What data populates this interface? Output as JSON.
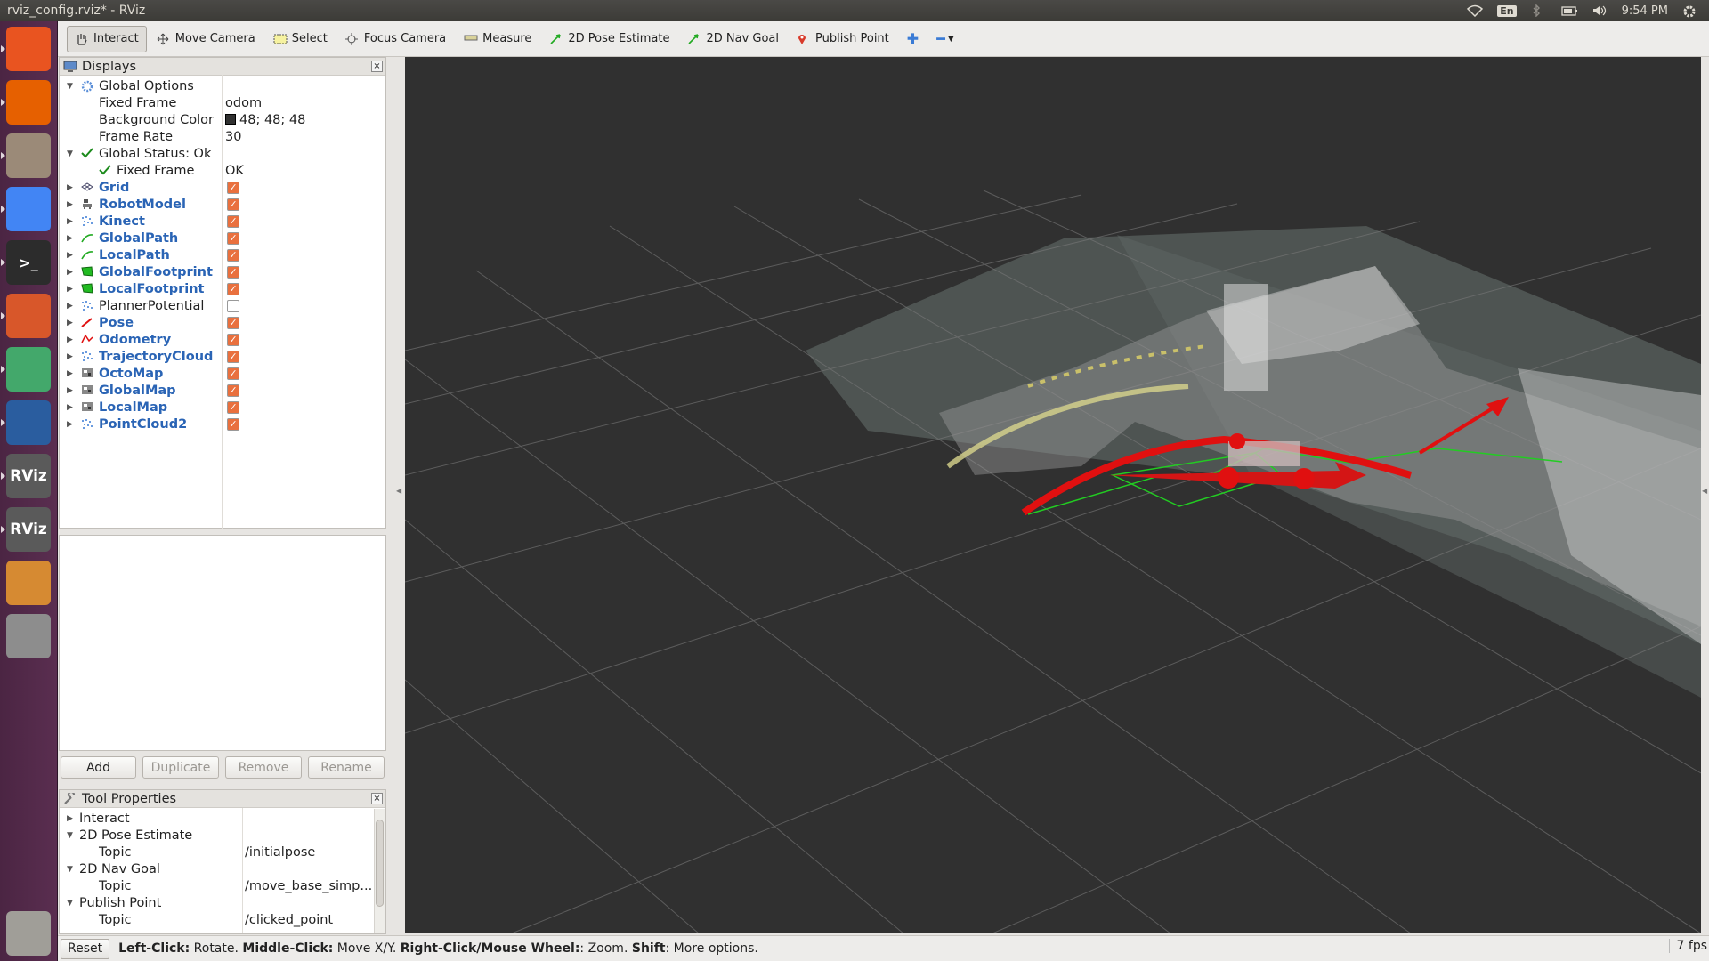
{
  "window": {
    "title": "rviz_config.rviz* - RViz"
  },
  "tray": {
    "keyboard": "En",
    "time": "9:54 PM"
  },
  "launcher": {
    "items": [
      {
        "name": "ubuntu-dash-icon",
        "color": "#e95420",
        "text": ""
      },
      {
        "name": "firefox-icon",
        "color": "#e66000",
        "text": ""
      },
      {
        "name": "files-icon",
        "color": "#9b8a78",
        "text": ""
      },
      {
        "name": "chrome-icon",
        "color": "#4285f4",
        "text": ""
      },
      {
        "name": "terminal-icon",
        "color": "#2c2c2c",
        "text": ">_"
      },
      {
        "name": "settings-icon",
        "color": "#d8572a",
        "text": ""
      },
      {
        "name": "atom-icon",
        "color": "#43a86b",
        "text": ""
      },
      {
        "name": "writer-icon",
        "color": "#2a5d9f",
        "text": ""
      },
      {
        "name": "rviz-icon",
        "color": "#5a5a5a",
        "text": "RViz"
      },
      {
        "name": "rviz-icon",
        "color": "#5a5a5a",
        "text": "RViz"
      },
      {
        "name": "sublime-icon",
        "color": "#d68a32",
        "text": ""
      },
      {
        "name": "drive-icon",
        "color": "#8d8d8d",
        "text": ""
      },
      {
        "name": "trash-icon",
        "color": "#a09e98",
        "text": ""
      }
    ]
  },
  "toolbar": {
    "tools": [
      {
        "label": "Interact",
        "icon": "hand-icon",
        "active": true
      },
      {
        "label": "Move Camera",
        "icon": "move-camera-icon",
        "active": false
      },
      {
        "label": "Select",
        "icon": "select-icon",
        "active": false
      },
      {
        "label": "Focus Camera",
        "icon": "focus-camera-icon",
        "active": false
      },
      {
        "label": "Measure",
        "icon": "ruler-icon",
        "active": false
      },
      {
        "label": "2D Pose Estimate",
        "icon": "pose-arrow-icon",
        "active": false
      },
      {
        "label": "2D Nav Goal",
        "icon": "nav-goal-icon",
        "active": false
      },
      {
        "label": "Publish Point",
        "icon": "map-pin-icon",
        "active": false
      }
    ]
  },
  "displays": {
    "title": "Displays",
    "global": [
      {
        "label": "Global Options",
        "indent": 1,
        "arrow": "▼",
        "icon": "gear-icon"
      },
      {
        "label": "Fixed Frame",
        "indent": 2,
        "value": "odom"
      },
      {
        "label": "Background Color",
        "indent": 2,
        "value": "48; 48; 48",
        "swatch": "#303030"
      },
      {
        "label": "Frame Rate",
        "indent": 2,
        "value": "30"
      },
      {
        "label": "Global Status: Ok",
        "indent": 1,
        "arrow": "▼",
        "icon": "check-icon"
      },
      {
        "label": "Fixed Frame",
        "indent": 2,
        "value": "OK",
        "icon": "check-icon"
      }
    ],
    "items": [
      {
        "label": "Grid",
        "icon": "grid-icon",
        "checked": true,
        "blue": true
      },
      {
        "label": "RobotModel",
        "icon": "robot-icon",
        "checked": true,
        "blue": true
      },
      {
        "label": "Kinect",
        "icon": "pointcloud-icon",
        "checked": true,
        "blue": true
      },
      {
        "label": "GlobalPath",
        "icon": "path-icon",
        "checked": true,
        "blue": true
      },
      {
        "label": "LocalPath",
        "icon": "path-icon",
        "checked": true,
        "blue": true
      },
      {
        "label": "GlobalFootprint",
        "icon": "polygon-icon",
        "checked": true,
        "blue": true
      },
      {
        "label": "LocalFootprint",
        "icon": "polygon-icon",
        "checked": true,
        "blue": true
      },
      {
        "label": "PlannerPotential",
        "icon": "pointcloud-icon",
        "checked": false,
        "blue": false
      },
      {
        "label": "Pose",
        "icon": "pose-icon",
        "checked": true,
        "blue": true
      },
      {
        "label": "Odometry",
        "icon": "odometry-icon",
        "checked": true,
        "blue": true
      },
      {
        "label": "TrajectoryCloud",
        "icon": "pointcloud-icon",
        "checked": true,
        "blue": true
      },
      {
        "label": "OctoMap",
        "icon": "map-icon",
        "checked": true,
        "blue": true
      },
      {
        "label": "GlobalMap",
        "icon": "map-icon",
        "checked": true,
        "blue": true
      },
      {
        "label": "LocalMap",
        "icon": "map-icon",
        "checked": true,
        "blue": true
      },
      {
        "label": "PointCloud2",
        "icon": "pointcloud-icon",
        "checked": true,
        "blue": true
      }
    ],
    "buttons": {
      "add": "Add",
      "duplicate": "Duplicate",
      "remove": "Remove",
      "rename": "Rename"
    }
  },
  "tool_properties": {
    "title": "Tool Properties",
    "rows": [
      {
        "label": "Interact",
        "indent": 1,
        "arrow": "▶",
        "value": ""
      },
      {
        "label": "2D Pose Estimate",
        "indent": 1,
        "arrow": "▼",
        "value": ""
      },
      {
        "label": "Topic",
        "indent": 2,
        "arrow": "",
        "value": "/initialpose"
      },
      {
        "label": "2D Nav Goal",
        "indent": 1,
        "arrow": "▼",
        "value": ""
      },
      {
        "label": "Topic",
        "indent": 2,
        "arrow": "",
        "value": "/move_base_simp..."
      },
      {
        "label": "Publish Point",
        "indent": 1,
        "arrow": "▼",
        "value": ""
      },
      {
        "label": "Topic",
        "indent": 2,
        "arrow": "",
        "value": "/clicked_point"
      }
    ]
  },
  "status": {
    "reset": "Reset",
    "help": [
      {
        "b": "Left-Click:",
        "t": " Rotate. "
      },
      {
        "b": "Middle-Click:",
        "t": " Move X/Y. "
      },
      {
        "b": "Right-Click/Mouse Wheel:",
        "t": ": Zoom. "
      },
      {
        "b": "Shift",
        "t": ": More options."
      }
    ],
    "fps": "7 fps"
  },
  "colors": {
    "background": "#303030",
    "robot": "#e01010",
    "path": "#d8d080",
    "footprint": "#22cc22"
  }
}
